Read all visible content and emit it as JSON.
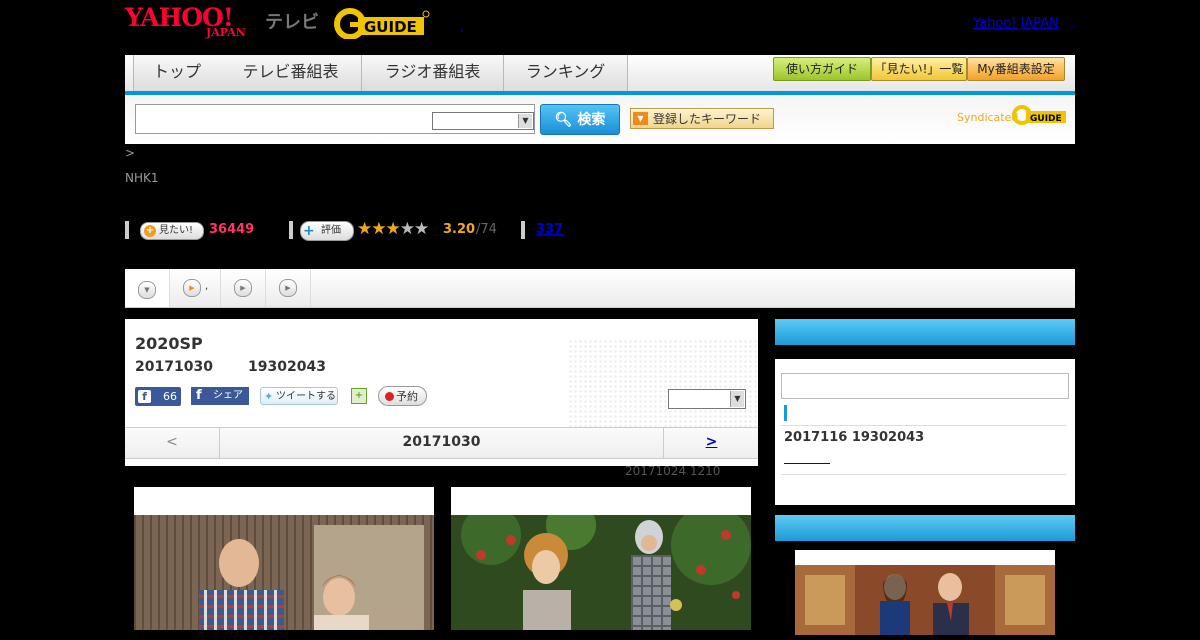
{
  "header": {
    "yahoo_logo": "YAHOO!",
    "yahoo_logo_sub": "JAPAN",
    "tv_label": "テレビ",
    "gguide_logo": "G-GUIDE",
    "top_right_link": "Yahoo! JAPAN",
    "top_right_dot": ".",
    "comma": ","
  },
  "nav": {
    "tabs": [
      "トップ",
      "テレビ番組表",
      "ラジオ番組表",
      "ランキング"
    ],
    "right_buttons": [
      "使い方ガイド",
      "「見たい!」一覧",
      "My番組表設定"
    ]
  },
  "search": {
    "input_value": "",
    "select_value": "",
    "button_label": "検索",
    "keyword_button_label": "登録したキーワード",
    "syndicated_label": "Syndicated",
    "syndicated_logo": "G-GUIDE"
  },
  "program_meta": {
    "breadcrumb": ">",
    "channel": "NHK1",
    "mitai_label": "見たい!",
    "mitai_count": "36449",
    "hyoka_label": "評価",
    "stars_filled": 3,
    "stars_total": 5,
    "rating": "3.20",
    "rating_count": "/74",
    "review_link": "337"
  },
  "tabstrip": {
    "tab2_text": ","
  },
  "main": {
    "title": "2020SP",
    "date": "20171030",
    "time": "19302043",
    "like_count": "66",
    "share_label": "シェア",
    "tweet_label": "ツイートする",
    "reserve_label": "予約",
    "select_value": "",
    "prev_label": "<",
    "current_day": "20171030",
    "next_label": ">",
    "update_note": "20171024  1210"
  },
  "sidebar": {
    "search_value": "",
    "date_time": "2017116  19302043",
    "link_text": ""
  },
  "colors": {
    "accent_blue": "#1a9ad8",
    "yahoo_red": "#ff0033",
    "gguide_yellow": "#f0c400",
    "mitai_pink": "#ff3366",
    "rating_orange": "#f0a81c"
  }
}
